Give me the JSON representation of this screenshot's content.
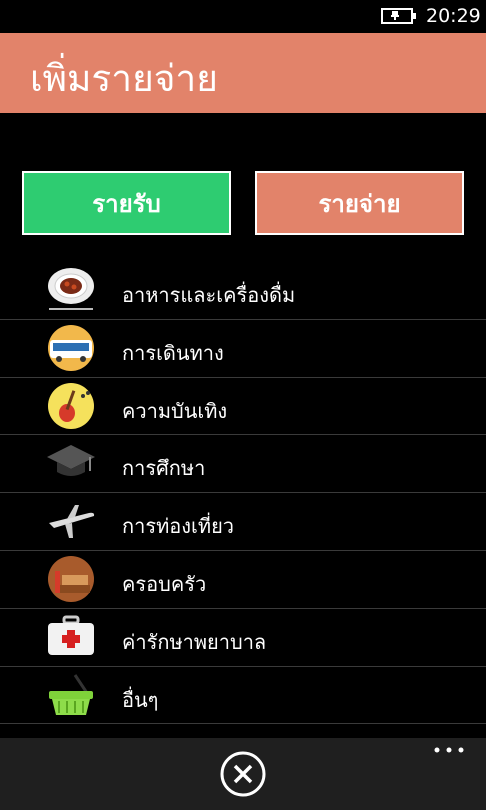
{
  "status": {
    "time": "20:29"
  },
  "header": {
    "title": "เพิ่มรายจ่าย"
  },
  "toggle": {
    "income_label": "รายรับ",
    "expense_label": "รายจ่าย",
    "income_color": "#2ecc71",
    "expense_color": "#e2836a"
  },
  "categories": [
    {
      "label": "อาหารและเครื่องดื่ม",
      "icon": "food-plate-icon"
    },
    {
      "label": "การเดินทาง",
      "icon": "bus-icon"
    },
    {
      "label": "ความบันเทิง",
      "icon": "guitar-icon"
    },
    {
      "label": "การศึกษา",
      "icon": "graduation-cap-icon"
    },
    {
      "label": "การท่องเที่ยว",
      "icon": "airplane-icon"
    },
    {
      "label": "ครอบครัว",
      "icon": "family-icon"
    },
    {
      "label": "ค่ารักษาพยาบาล",
      "icon": "first-aid-kit-icon"
    },
    {
      "label": "อื่นๆ",
      "icon": "basket-icon"
    }
  ],
  "colors": {
    "header": "#e2836a",
    "background": "#000000",
    "app_bar": "#1f1f1f"
  }
}
